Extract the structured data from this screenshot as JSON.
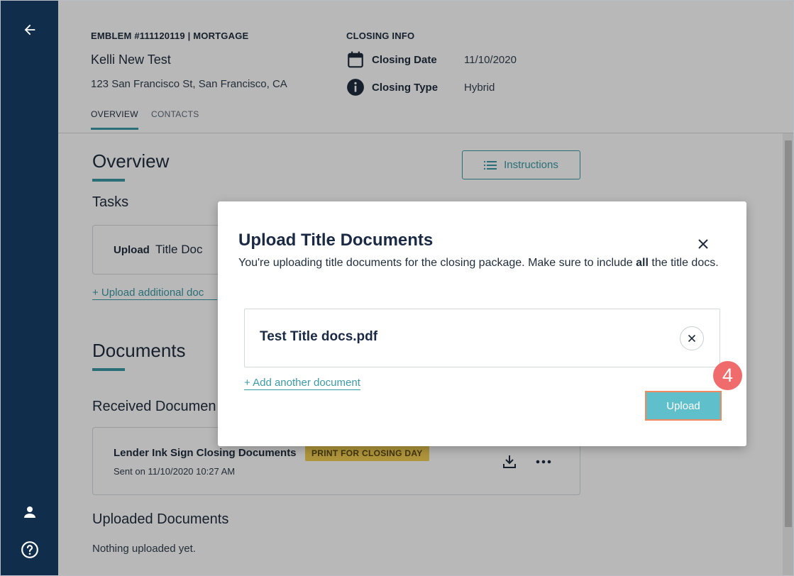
{
  "colors": {
    "sidebar": "#102d4b",
    "accent": "#3b9aa5",
    "upload_button": "#5fc0cc",
    "highlight_border": "#f08a5d",
    "step_marker": "#f06b6b",
    "badge": "#f1cd52"
  },
  "sidebar": {
    "icons": [
      "back-arrow-icon",
      "user-icon",
      "help-icon"
    ]
  },
  "header": {
    "emblem": "EMBLEM #111120119 | MORTGAGE",
    "client_name": "Kelli New Test",
    "address": "123 San Francisco St, San Francisco, CA",
    "tabs": [
      {
        "label": "OVERVIEW",
        "active": true
      },
      {
        "label": "CONTACTS",
        "active": false
      }
    ],
    "closing_info": {
      "title": "CLOSING INFO",
      "rows": [
        {
          "icon": "calendar-icon",
          "label": "Closing Date",
          "value": "11/10/2020"
        },
        {
          "icon": "info-icon",
          "label": "Closing Type",
          "value": "Hybrid"
        }
      ]
    }
  },
  "overview": {
    "title": "Overview",
    "instructions_label": "Instructions",
    "tasks_title": "Tasks",
    "task": {
      "action": "Upload",
      "doc": "Title Doc"
    },
    "upload_additional_label": "+ Upload additional doc"
  },
  "documents": {
    "title": "Documents",
    "received_title": "Received Documen",
    "received": [
      {
        "title": "Lender Ink Sign Closing Documents",
        "badge": "PRINT FOR CLOSING DAY",
        "sent": "Sent on 11/10/2020 10:27 AM"
      }
    ],
    "uploaded_title": "Uploaded Documents",
    "uploaded_empty": "Nothing uploaded yet."
  },
  "modal": {
    "title": "Upload Title Documents",
    "desc_pre": "You're uploading title documents for the closing package. Make sure to include ",
    "desc_bold": "all",
    "desc_post": " the title docs.",
    "file_name": "Test Title docs.pdf",
    "add_another_label": "+ Add another document",
    "upload_label": "Upload"
  },
  "step_marker": "4"
}
